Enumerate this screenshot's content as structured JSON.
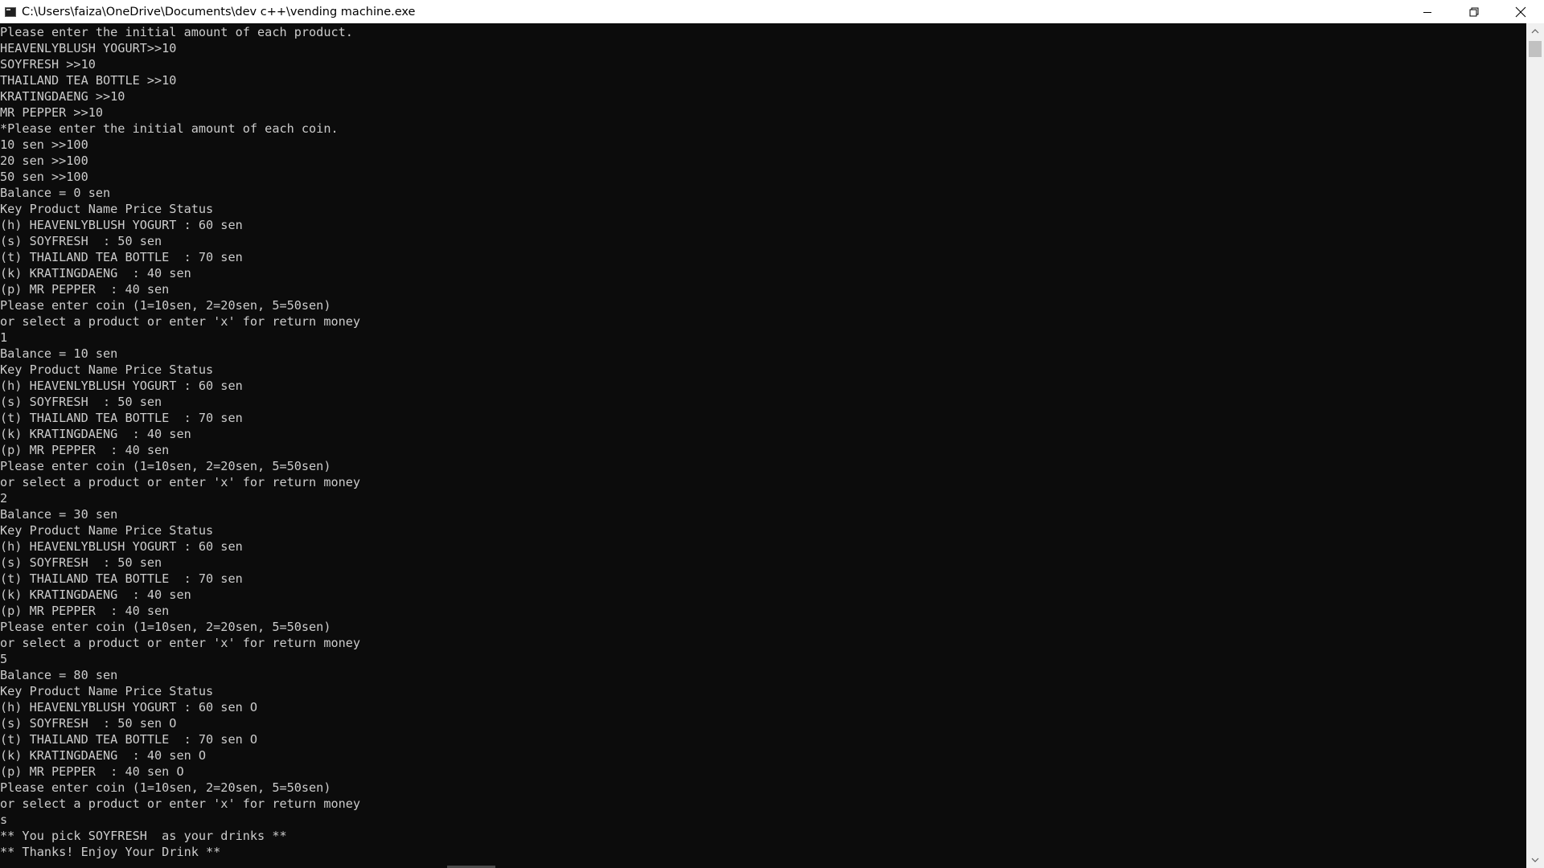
{
  "window": {
    "title": "C:\\Users\\faiza\\OneDrive\\Documents\\dev c++\\vending machine.exe",
    "icon": "console-app-icon"
  },
  "controls": {
    "minimize_icon": "minimize-icon",
    "restore_icon": "restore-icon",
    "close_icon": "close-icon"
  },
  "console": {
    "text_color": "#cccccc",
    "background": "#0c0c0c",
    "lines": [
      "Please enter the initial amount of each product.",
      "HEAVENLYBLUSH YOGURT>>10",
      "SOYFRESH >>10",
      "THAILAND TEA BOTTLE >>10",
      "KRATINGDAENG >>10",
      "MR PEPPER >>10",
      "*Please enter the initial amount of each coin.",
      "10 sen >>100",
      "20 sen >>100",
      "50 sen >>100",
      "Balance = 0 sen",
      "Key Product Name Price Status",
      "(h) HEAVENLYBLUSH YOGURT : 60 sen",
      "(s) SOYFRESH  : 50 sen",
      "(t) THAILAND TEA BOTTLE  : 70 sen",
      "(k) KRATINGDAENG  : 40 sen",
      "(p) MR PEPPER  : 40 sen",
      "Please enter coin (1=10sen, 2=20sen, 5=50sen)",
      "or select a product or enter 'x' for return money",
      "1",
      "Balance = 10 sen",
      "Key Product Name Price Status",
      "(h) HEAVENLYBLUSH YOGURT : 60 sen",
      "(s) SOYFRESH  : 50 sen",
      "(t) THAILAND TEA BOTTLE  : 70 sen",
      "(k) KRATINGDAENG  : 40 sen",
      "(p) MR PEPPER  : 40 sen",
      "Please enter coin (1=10sen, 2=20sen, 5=50sen)",
      "or select a product or enter 'x' for return money",
      "2",
      "Balance = 30 sen",
      "Key Product Name Price Status",
      "(h) HEAVENLYBLUSH YOGURT : 60 sen",
      "(s) SOYFRESH  : 50 sen",
      "(t) THAILAND TEA BOTTLE  : 70 sen",
      "(k) KRATINGDAENG  : 40 sen",
      "(p) MR PEPPER  : 40 sen",
      "Please enter coin (1=10sen, 2=20sen, 5=50sen)",
      "or select a product or enter 'x' for return money",
      "5",
      "Balance = 80 sen",
      "Key Product Name Price Status",
      "(h) HEAVENLYBLUSH YOGURT : 60 sen O",
      "(s) SOYFRESH  : 50 sen O",
      "(t) THAILAND TEA BOTTLE  : 70 sen O",
      "(k) KRATINGDAENG  : 40 sen O",
      "(p) MR PEPPER  : 40 sen O",
      "Please enter coin (1=10sen, 2=20sen, 5=50sen)",
      "or select a product or enter 'x' for return money",
      "s",
      "** You pick SOYFRESH  as your drinks **",
      "** Thanks! Enjoy Your Drink **"
    ]
  },
  "scrollbar": {
    "up_icon": "scroll-up-arrow-icon",
    "down_icon": "scroll-down-arrow-icon"
  }
}
